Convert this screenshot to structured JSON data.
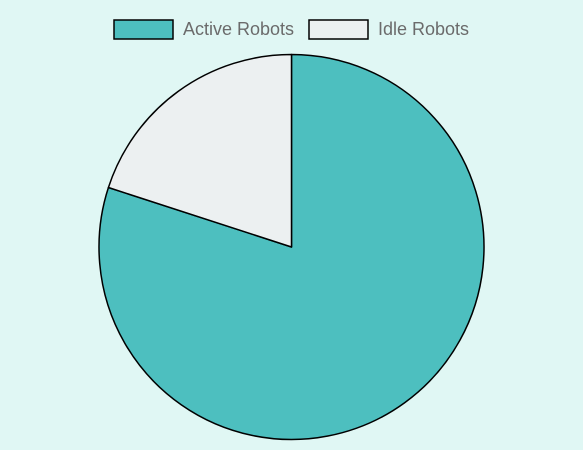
{
  "chart_data": {
    "type": "pie",
    "legend_position": "top",
    "slices": [
      {
        "label": "Active Robots",
        "value": 80,
        "color": "#4dbfbf"
      },
      {
        "label": "Idle Robots",
        "value": 20,
        "color": "#ecf0f1"
      }
    ],
    "border_color": "#000000"
  }
}
